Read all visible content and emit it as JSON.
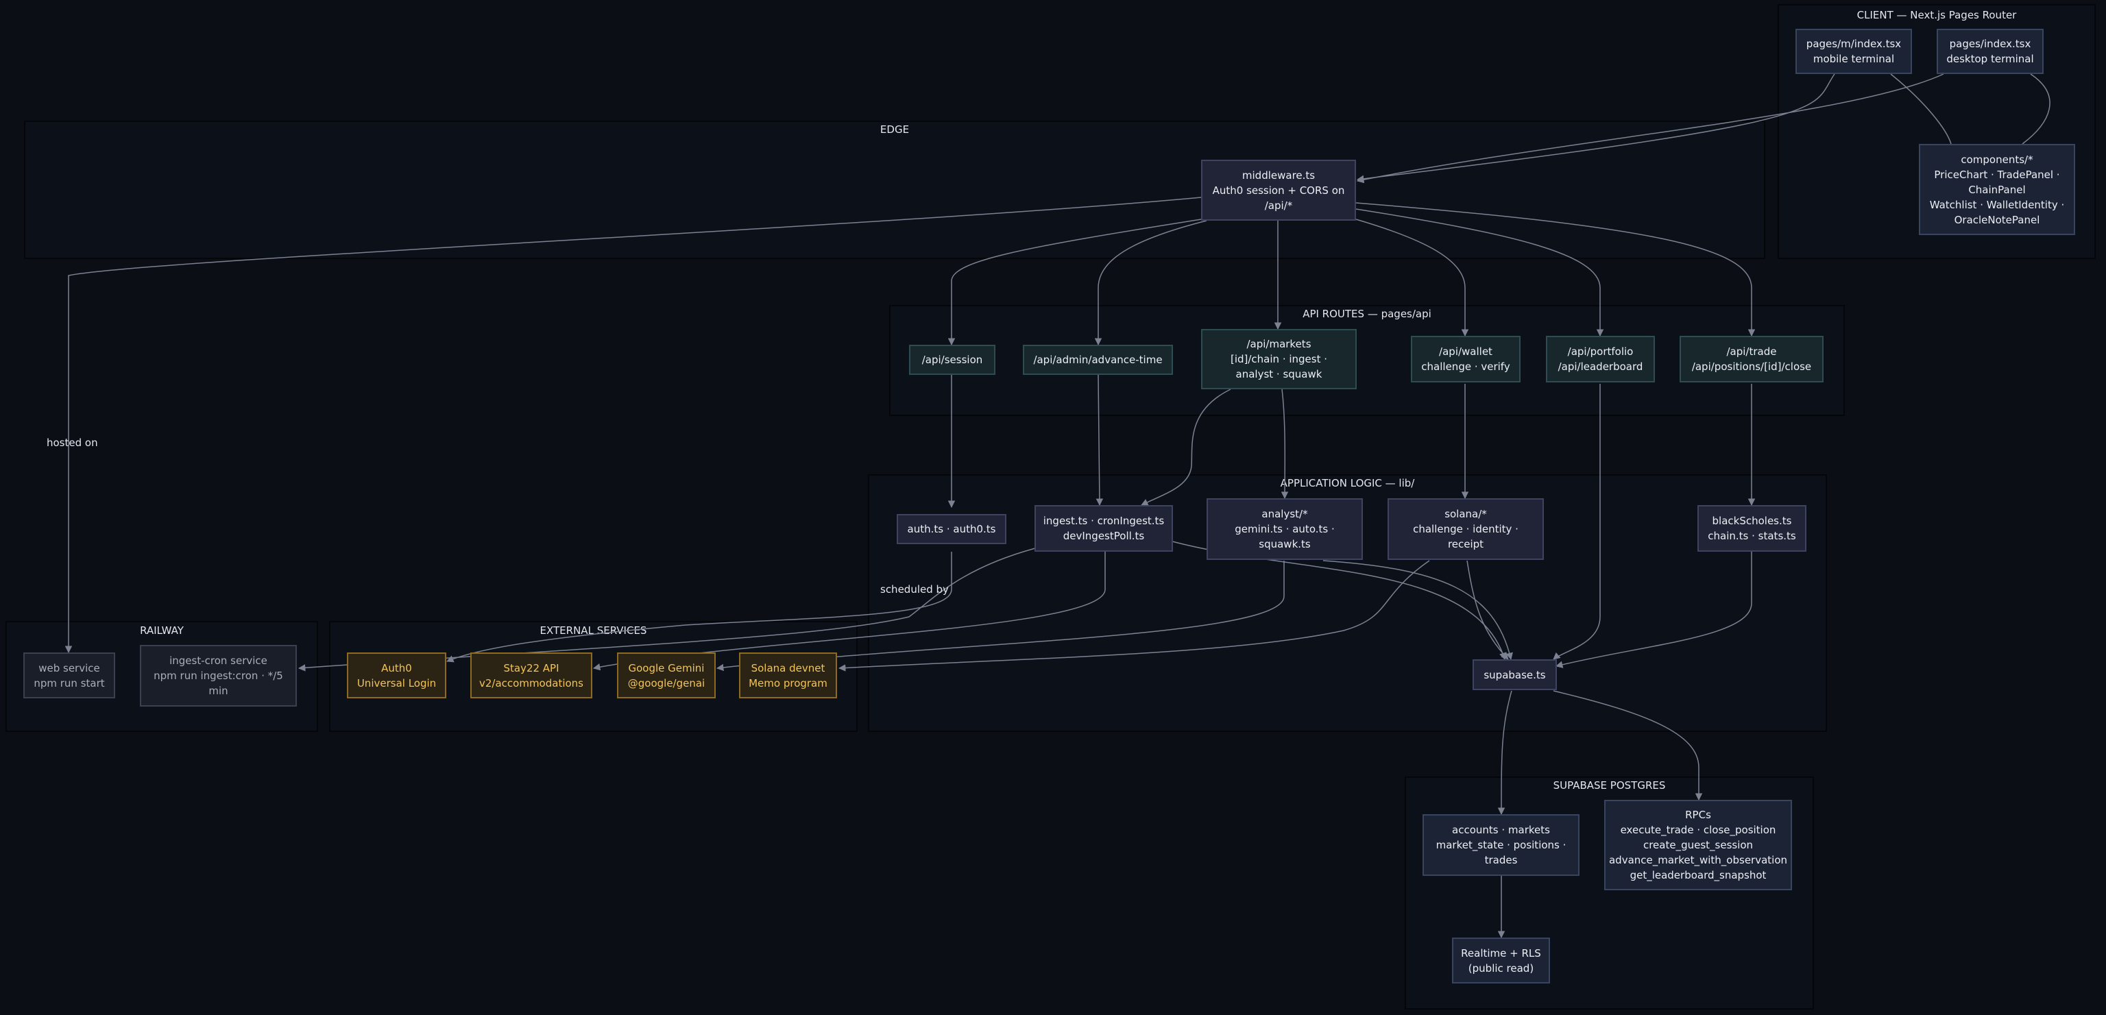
{
  "groups": {
    "edge": "EDGE",
    "client": "CLIENT — Next.js Pages Router",
    "api": "API ROUTES — pages/api",
    "logic": "APPLICATION LOGIC — lib/",
    "railway": "RAILWAY",
    "external": "EXTERNAL SERVICES",
    "supabase": "SUPABASE POSTGRES"
  },
  "nodes": {
    "middleware": "middleware.ts\nAuth0 session + CORS on\n/api/*",
    "pages_mobile": "pages/m/index.tsx\nmobile terminal",
    "pages_desktop": "pages/index.tsx\ndesktop terminal",
    "components": "components/*\nPriceChart · TradePanel ·\nChainPanel\nWatchlist · WalletIdentity ·\nOracleNotePanel",
    "api_session": "/api/session",
    "api_admin": "/api/admin/advance-time",
    "api_markets": "/api/markets\n[id]/chain · ingest ·\nanalyst · squawk",
    "api_wallet": "/api/wallet\nchallenge · verify",
    "api_portfolio": "/api/portfolio\n/api/leaderboard",
    "api_trade": "/api/trade\n/api/positions/[id]/close",
    "auth": "auth.ts · auth0.ts",
    "ingest": "ingest.ts · cronIngest.ts\ndevIngestPoll.ts",
    "analyst": "analyst/*\ngemini.ts · auto.ts ·\nsquawk.ts",
    "solana": "solana/*\nchallenge · identity ·\nreceipt",
    "blackscholes": "blackScholes.ts\nchain.ts · stats.ts",
    "supabase_ts": "supabase.ts",
    "web_service": "web service\nnpm run start",
    "cron_service": "ingest-cron service\nnpm run ingest:cron · */5\nmin",
    "auth0": "Auth0\nUniversal Login",
    "stay22": "Stay22 API\nv2/accommodations",
    "gemini": "Google Gemini\n@google/genai",
    "solana_devnet": "Solana devnet\nMemo program",
    "tables": "accounts · markets\nmarket_state · positions ·\ntrades",
    "rpcs": "RPCs\nexecute_trade · close_position\ncreate_guest_session\nadvance_market_with_observation\nget_leaderboard_snapshot",
    "realtime": "Realtime + RLS\n(public read)"
  },
  "edge_labels": {
    "hosted_on": "hosted on",
    "scheduled_by": "scheduled by"
  },
  "colors": {
    "background": "#0b0e15",
    "edge": "#7d8293",
    "external_text": "#f2c45a"
  }
}
